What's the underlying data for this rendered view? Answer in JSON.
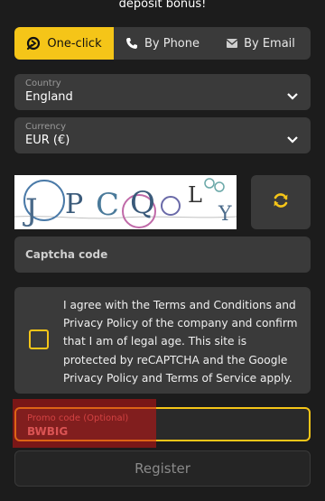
{
  "header": {
    "bonus_text": "deposit bonus!"
  },
  "tabs": [
    {
      "label": "One-click",
      "icon": "one-click-icon",
      "active": true
    },
    {
      "label": "By Phone",
      "icon": "phone-icon",
      "active": false
    },
    {
      "label": "By Email",
      "icon": "email-icon",
      "active": false
    }
  ],
  "country": {
    "label": "Country",
    "value": "England"
  },
  "currency": {
    "label": "Currency",
    "value": "EUR (€)"
  },
  "captcha": {
    "chars": [
      "J",
      "P",
      "C",
      "Q",
      "L",
      "Y"
    ],
    "input_placeholder": "Captcha code"
  },
  "agreement": {
    "text": "I agree with the Terms and Conditions and Privacy Policy of the company and confirm that I am of legal age. This site is protected by reCAPTCHA and the Google Privacy Policy and Terms of Service apply.",
    "checked": false
  },
  "promo": {
    "label": "Promo code (Optional)",
    "value": "BWBIG"
  },
  "register": {
    "label": "Register"
  },
  "colors": {
    "accent": "#f5c518",
    "background": "#1c1c1c",
    "field": "#3a3a3a"
  }
}
